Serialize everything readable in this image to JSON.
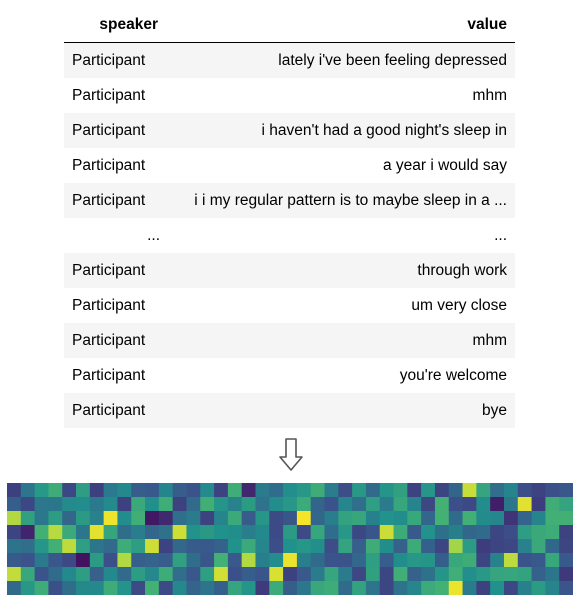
{
  "table": {
    "header_speaker": "speaker",
    "header_value": "value",
    "rows": [
      {
        "speaker": "Participant",
        "value": "lately i've been feeling depressed"
      },
      {
        "speaker": "Participant",
        "value": "mhm"
      },
      {
        "speaker": "Participant",
        "value": "i haven't had a good night's sleep in"
      },
      {
        "speaker": "Participant",
        "value": "a year i would say"
      },
      {
        "speaker": "Participant",
        "value": "i i my regular pattern is to maybe sleep in a ..."
      },
      {
        "speaker": "...",
        "value": "..."
      },
      {
        "speaker": "Participant",
        "value": "through work"
      },
      {
        "speaker": "Participant",
        "value": "um very close"
      },
      {
        "speaker": "Participant",
        "value": "mhm"
      },
      {
        "speaker": "Participant",
        "value": "you're welcome"
      },
      {
        "speaker": "Participant",
        "value": "bye"
      }
    ]
  },
  "arrow": {
    "icon": "down-arrow-icon",
    "direction": "down"
  },
  "heatmap": {
    "colormap": "viridis",
    "colors": [
      "#440154",
      "#3b528b",
      "#21918c",
      "#5ec962",
      "#fde725"
    ]
  }
}
